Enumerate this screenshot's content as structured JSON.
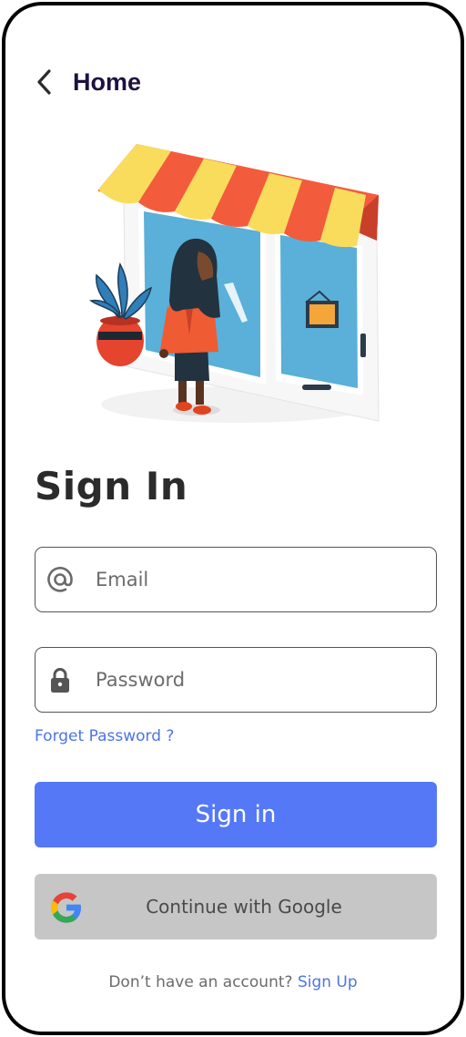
{
  "header": {
    "back_icon": "chevron-left-icon",
    "title": "Home"
  },
  "illustration": {
    "subject": "woman standing in front of shop window with striped awning",
    "colors": {
      "awning_yellow": "#f9dc5c",
      "awning_red": "#f25c3c",
      "window_blue": "#5ab0d8",
      "jacket": "#ef5b33"
    }
  },
  "page": {
    "title": "Sign In"
  },
  "form": {
    "email": {
      "icon": "at-sign-icon",
      "placeholder": "Email",
      "value": ""
    },
    "password": {
      "icon": "lock-icon",
      "placeholder": "Password",
      "value": ""
    },
    "forgot_label": "Forget Password ?"
  },
  "actions": {
    "signin_label": "Sign in",
    "google_label": "Continue with Google",
    "google_icon": "google-logo-icon"
  },
  "footer": {
    "prompt": "Don’t have an account?",
    "signup_label": "Sign Up"
  },
  "colors": {
    "primary": "#5578f7",
    "link": "#4d74e8",
    "google_button_bg": "#c6c6c6",
    "title_text": "#2b2b2b",
    "home_text": "#1e1240"
  }
}
